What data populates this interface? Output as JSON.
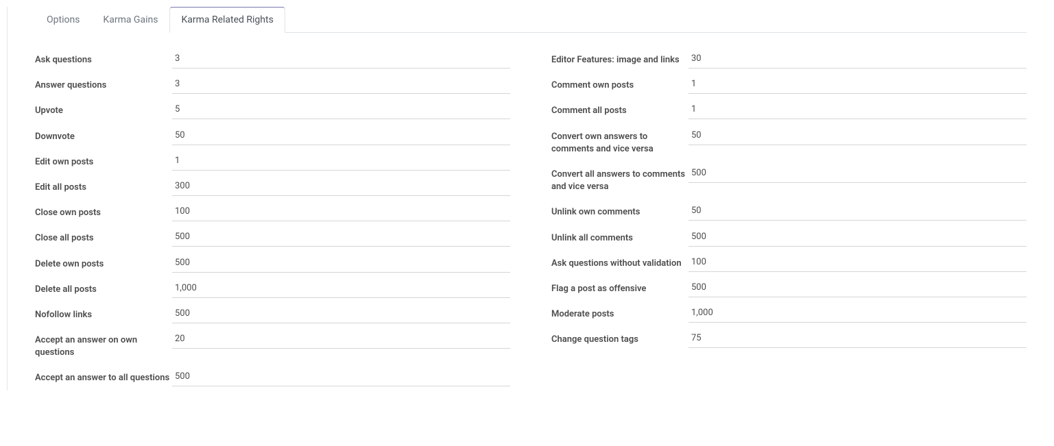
{
  "tabs": {
    "options": "Options",
    "karma_gains": "Karma Gains",
    "karma_rights": "Karma Related Rights"
  },
  "left_fields": [
    {
      "label": "Ask questions",
      "value": "3",
      "name": "ask-questions"
    },
    {
      "label": "Answer questions",
      "value": "3",
      "name": "answer-questions"
    },
    {
      "label": "Upvote",
      "value": "5",
      "name": "upvote"
    },
    {
      "label": "Downvote",
      "value": "50",
      "name": "downvote"
    },
    {
      "label": "Edit own posts",
      "value": "1",
      "name": "edit-own-posts"
    },
    {
      "label": "Edit all posts",
      "value": "300",
      "name": "edit-all-posts"
    },
    {
      "label": "Close own posts",
      "value": "100",
      "name": "close-own-posts"
    },
    {
      "label": "Close all posts",
      "value": "500",
      "name": "close-all-posts"
    },
    {
      "label": "Delete own posts",
      "value": "500",
      "name": "delete-own-posts"
    },
    {
      "label": "Delete all posts",
      "value": "1,000",
      "name": "delete-all-posts"
    },
    {
      "label": "Nofollow links",
      "value": "500",
      "name": "nofollow-links"
    },
    {
      "label": "Accept an answer on own questions",
      "value": "20",
      "name": "accept-answer-own"
    },
    {
      "label": "Accept an answer to all questions",
      "value": "500",
      "name": "accept-answer-all"
    }
  ],
  "right_fields": [
    {
      "label": "Editor Features: image and links",
      "value": "30",
      "name": "editor-features"
    },
    {
      "label": "Comment own posts",
      "value": "1",
      "name": "comment-own-posts"
    },
    {
      "label": "Comment all posts",
      "value": "1",
      "name": "comment-all-posts"
    },
    {
      "label": "Convert own answers to comments and vice versa",
      "value": "50",
      "name": "convert-own-answers"
    },
    {
      "label": "Convert all answers to comments and vice versa",
      "value": "500",
      "name": "convert-all-answers"
    },
    {
      "label": "Unlink own comments",
      "value": "50",
      "name": "unlink-own-comments"
    },
    {
      "label": "Unlink all comments",
      "value": "500",
      "name": "unlink-all-comments"
    },
    {
      "label": "Ask questions without validation",
      "value": "100",
      "name": "ask-without-validation"
    },
    {
      "label": "Flag a post as offensive",
      "value": "500",
      "name": "flag-offensive"
    },
    {
      "label": "Moderate posts",
      "value": "1,000",
      "name": "moderate-posts"
    },
    {
      "label": "Change question tags",
      "value": "75",
      "name": "change-question-tags"
    }
  ]
}
